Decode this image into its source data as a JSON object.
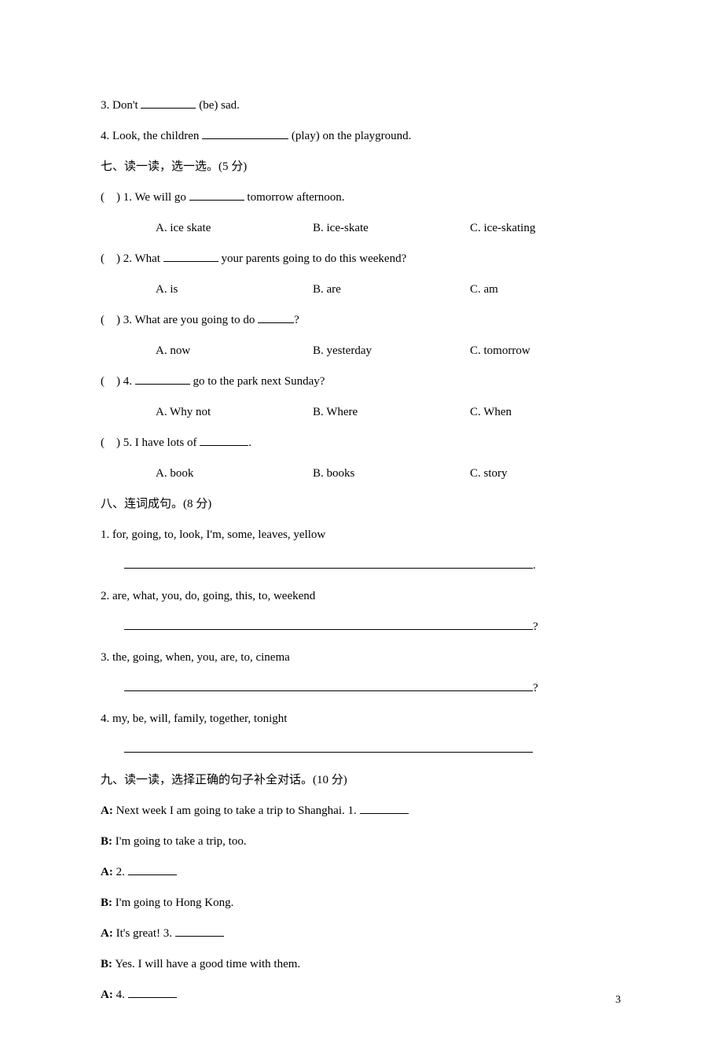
{
  "q6": {
    "item3_pre": "3. Don't ",
    "item3_post": " (be) sad.",
    "item4_pre": "4. Look, the children ",
    "item4_post": " (play) on the playground."
  },
  "s7": {
    "heading": "七、读一读，选一选。(5 分)",
    "items": [
      {
        "stem_pre": "(    ) 1. We will go ",
        "stem_post": " tomorrow afternoon.",
        "a": "A. ice skate",
        "b": "B. ice-skate",
        "c": "C. ice-skating"
      },
      {
        "stem_pre": "(    ) 2. What ",
        "stem_post": " your parents going to do this weekend?",
        "a": "A. is",
        "b": "B. are",
        "c": "C. am"
      },
      {
        "stem_pre": "(    ) 3. What are you going to do ",
        "stem_post": "?",
        "a": "A. now",
        "b": "B. yesterday",
        "c": "C. tomorrow"
      },
      {
        "stem_pre": "(    ) 4. ",
        "stem_post": " go to the park next Sunday?",
        "a": "A. Why not",
        "b": "B. Where",
        "c": "C. When"
      },
      {
        "stem_pre": "(    ) 5. I have lots of ",
        "stem_post": ".",
        "a": "A. book",
        "b": "B. books",
        "c": "C. story"
      }
    ]
  },
  "s8": {
    "heading": "八、连词成句。(8 分)",
    "items": [
      {
        "text": "1. for, going, to, look, I'm, some, leaves, yellow",
        "end": "."
      },
      {
        "text": "2. are, what, you, do, going, this, to, weekend",
        "end": "?"
      },
      {
        "text": "3. the, going, when, you, are, to, cinema",
        "end": "?"
      },
      {
        "text": "4. my, be, will, family, together, tonight",
        "end": ""
      }
    ]
  },
  "s9": {
    "heading": "九、读一读，选择正确的句子补全对话。(10 分)",
    "lines": [
      {
        "speaker": "A:",
        "pre": " Next week I am going to take a trip to Shanghai. 1. ",
        "blank": true
      },
      {
        "speaker": "B:",
        "pre": " I'm going to take a trip, too.",
        "blank": false
      },
      {
        "speaker": "A:",
        "pre": " 2. ",
        "blank": true
      },
      {
        "speaker": "B:",
        "pre": " I'm going to Hong Kong.",
        "blank": false
      },
      {
        "speaker": "A:",
        "pre": " It's great! 3. ",
        "blank": true
      },
      {
        "speaker": "B:",
        "pre": " Yes. I will have a good time with them.",
        "blank": false
      },
      {
        "speaker": "A:",
        "pre": " 4. ",
        "blank": true
      }
    ]
  },
  "page_number": "3"
}
